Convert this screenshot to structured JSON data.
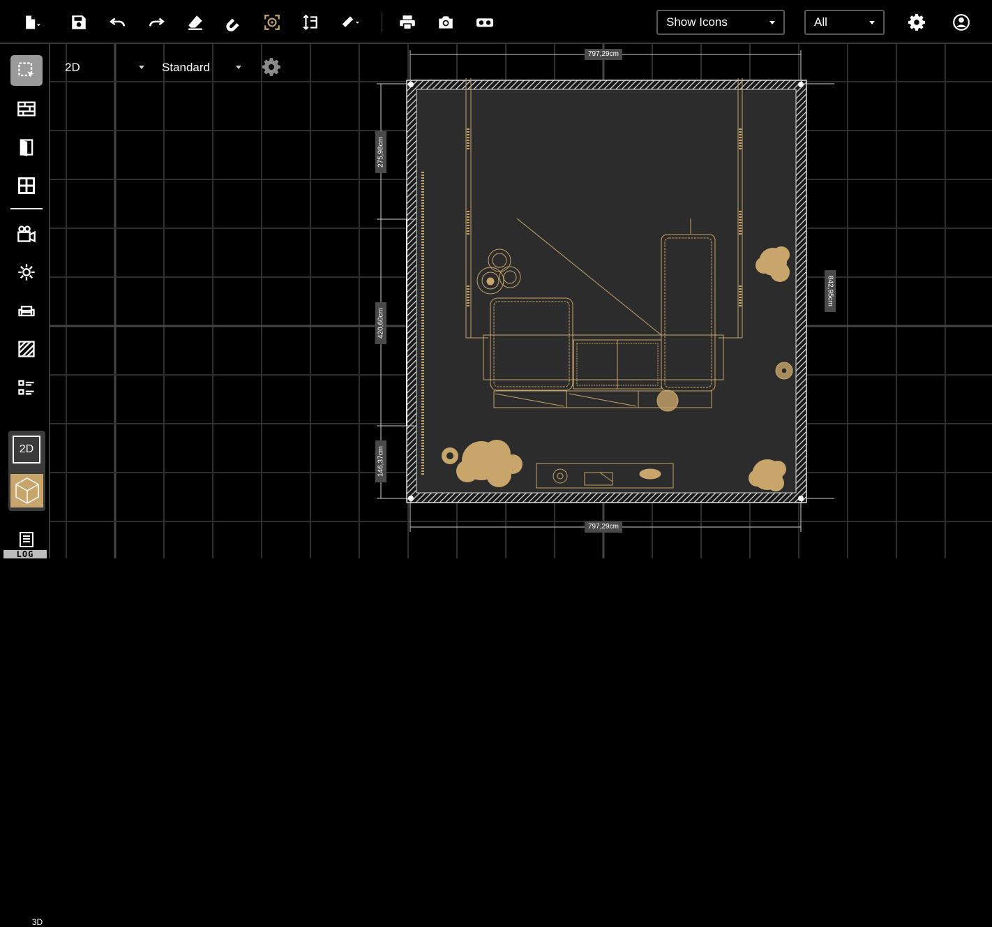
{
  "toolbar": {
    "icons": [
      "new-file-icon",
      "save-icon",
      "undo-icon",
      "redo-icon",
      "eraser-icon",
      "magnet-icon",
      "focus-target-icon",
      "height-tool-icon",
      "ruler-icon",
      "print-icon",
      "camera-icon",
      "vr-headset-icon",
      "settings-gear-icon",
      "user-account-icon"
    ],
    "display_dropdown": "Show Icons",
    "filter_dropdown": "All"
  },
  "sidebar": {
    "tools": [
      "select-tool-icon",
      "wall-tool-icon",
      "door-tool-icon",
      "window-tool-icon",
      "camera-tool-icon",
      "light-tool-icon",
      "furniture-tool-icon",
      "floor-hatch-tool-icon",
      "layers-list-icon"
    ],
    "mode_2d": "2D",
    "mode_3d": "3D",
    "log_label": "LOG"
  },
  "view": {
    "mode_select": "2D",
    "style_select": "Standard"
  },
  "dimensions": {
    "top": "797,29cm",
    "bottom": "797,29cm",
    "right": "842,95cm",
    "left_top": "275,98cm",
    "left_mid": "420,60cm",
    "left_bottom": "146,37cm"
  },
  "colors": {
    "background": "#000000",
    "grid": "#3a3a3a",
    "room_floor": "#2c2c2c",
    "wireframe": "#c8a56a",
    "accent_3d": "#c8a56a"
  }
}
